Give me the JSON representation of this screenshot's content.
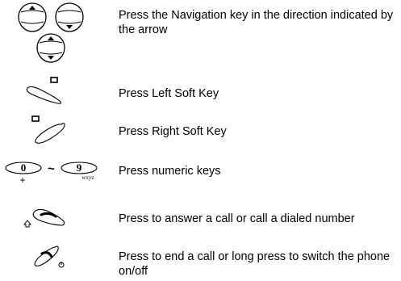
{
  "legend": {
    "rows": [
      {
        "icon": "navigation-key-icons",
        "text": "Press the Navigation key in the direction indicated by the arrow"
      },
      {
        "icon": "left-soft-key-icon",
        "text": "Press Left Soft Key"
      },
      {
        "icon": "right-soft-key-icon",
        "text": "Press Right Soft Key"
      },
      {
        "icon": "numeric-keys-icon",
        "text": "Press numeric keys",
        "key_first_digit": "0",
        "key_first_sub": "+",
        "key_separator": "~",
        "key_last_digit": "9",
        "key_last_sub": "wxyz"
      },
      {
        "icon": "send-key-icon",
        "text": "Press to answer a call or call a dialed number"
      },
      {
        "icon": "end-key-icon",
        "text": "Press to end a call or long press to switch the phone on/off"
      }
    ]
  }
}
